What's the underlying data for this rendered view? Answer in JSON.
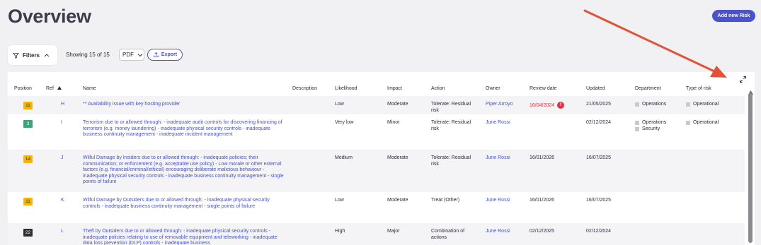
{
  "page": {
    "title": "Overview",
    "add_button": "Add new Risk"
  },
  "toolbar": {
    "filters_label": "Filters",
    "showing": "Showing 15 of 15",
    "format_value": "PDF",
    "export_label": "Export"
  },
  "table": {
    "headers": [
      "Position",
      "Ref",
      "Name",
      "Description",
      "Likelihood",
      "Impact",
      "Action",
      "Owner",
      "Review date",
      "Updated",
      "Department",
      "Type of risk"
    ],
    "rows": [
      {
        "position": "11",
        "badge_color": "#f5b800",
        "ref": "H",
        "name": "** Availability issue with key hosting provider",
        "description": "",
        "likelihood": "Low",
        "impact": "Moderate",
        "action": "Tolerate: Residual risk",
        "owner": "Piper Arroyo",
        "review": "16/04/2024",
        "review_overdue": true,
        "updated": "21/05/2025",
        "departments": [
          "Operations"
        ],
        "types": [
          "Operational"
        ]
      },
      {
        "position": "3",
        "badge_color": "#3aa57a",
        "ref": "I",
        "name": "Terrorism due to or allowed through: - inadequate audit controls for discovering financing of terrorism (e.g. money laundering) - inadequate physical security controls - inadequate business continuity management - inadequate incident management",
        "description": "",
        "likelihood": "Very low",
        "impact": "Minor",
        "action": "Tolerate: Residual risk",
        "owner": "June Rossi",
        "review": "",
        "review_overdue": false,
        "updated": "02/12/2024",
        "departments": [
          "Operations",
          "Security"
        ],
        "types": [
          "Operational"
        ]
      },
      {
        "position": "14",
        "badge_color": "#f5b800",
        "ref": "J",
        "name": "Wilful Damage by Insiders due to or allowed through: - inadequate policies; their communication; or enforcement (e.g. acceptable use policy) - Low morale or other external factors (e.g. financial/criminal/ethical) encouraging deliberate malicious behaviour - inadequate physical security controls - inadequate business continuity management - single points of failure",
        "description": "",
        "likelihood": "Medium",
        "impact": "Moderate",
        "action": "Tolerate: Residual risk",
        "owner": "June Rossi",
        "review": "16/01/2026",
        "review_overdue": false,
        "updated": "16/07/2025",
        "departments": [],
        "types": []
      },
      {
        "position": "11",
        "badge_color": "#f5b800",
        "ref": "K",
        "name": "Wilful Damage by Outsiders due to or allowed through: - inadequate physical security controls - inadequate business continuity management - single points of failure",
        "description": "",
        "likelihood": "Low",
        "impact": "Moderate",
        "action": "Treat (Other)",
        "owner": "June Rossi",
        "review": "16/01/2026",
        "review_overdue": false,
        "updated": "16/07/2025",
        "departments": [],
        "types": []
      },
      {
        "position": "22",
        "badge_color": "#2d2d35",
        "ref": "L",
        "name": "Theft by Outsiders due to or allowed through: - inadequate physical security controls - inadequate policies relating to use of removable equipment and teleworking - inadequate data loss prevention (DLP) controls - inadequate business",
        "description": "",
        "likelihood": "High",
        "impact": "Major",
        "action": "Combination of actions",
        "owner": "June Rossi",
        "review": "02/12/2025",
        "review_overdue": false,
        "updated": "02/12/2024",
        "departments": [],
        "types": []
      }
    ]
  },
  "colors": {
    "accent": "#4a53c9",
    "link": "#4652c4",
    "overdue": "#dc3545",
    "annotation_arrow": "#e0533a"
  },
  "icons": {
    "filter": "funnel-icon",
    "expand": "expand-icon",
    "export": "upload-icon",
    "sort": "sort-asc-icon"
  }
}
